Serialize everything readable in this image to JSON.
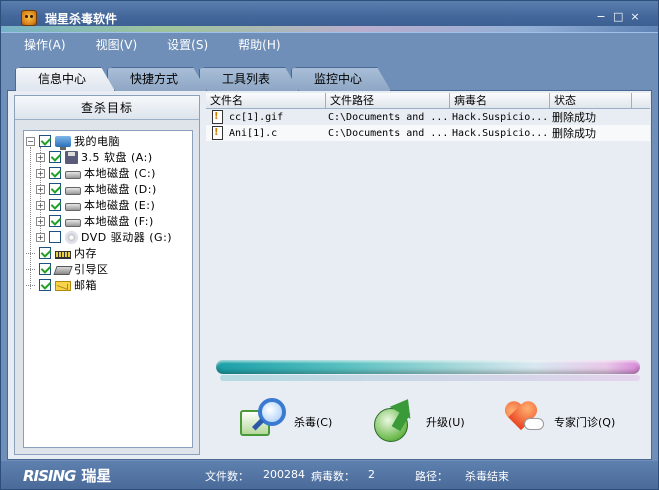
{
  "window": {
    "title": "瑞星杀毒软件",
    "controls": [
      "−",
      "□",
      "×"
    ]
  },
  "menu": [
    "操作(A)",
    "视图(V)",
    "设置(S)",
    "帮助(H)"
  ],
  "tabs": [
    "信息中心",
    "快捷方式",
    "工具列表",
    "监控中心"
  ],
  "left_panel": {
    "title": "查杀目标",
    "tree": {
      "root": "我的电脑",
      "drives": [
        {
          "label": "3.5 软盘 (A:)",
          "icon": "floppy-icon"
        },
        {
          "label": "本地磁盘 (C:)",
          "icon": "disk-icon"
        },
        {
          "label": "本地磁盘 (D:)",
          "icon": "disk-icon"
        },
        {
          "label": "本地磁盘 (E:)",
          "icon": "disk-icon"
        },
        {
          "label": "本地磁盘 (F:)",
          "icon": "disk-icon"
        },
        {
          "label": "DVD 驱动器 (G:)",
          "icon": "dvd-icon"
        }
      ],
      "others": [
        {
          "label": "内存",
          "icon": "memory-icon"
        },
        {
          "label": "引导区",
          "icon": "boot-sector-icon"
        },
        {
          "label": "邮箱",
          "icon": "mail-icon"
        }
      ]
    }
  },
  "list": {
    "columns": [
      "文件名",
      "文件路径",
      "病毒名",
      "状态"
    ],
    "rows": [
      {
        "filename": "cc[1].gif",
        "path": "C:\\Documents and ...",
        "virus": "Hack.Suspicio...",
        "status": "删除成功"
      },
      {
        "filename": "Ani[1].c",
        "path": "C:\\Documents and ...",
        "virus": "Hack.Suspicio...",
        "status": "删除成功"
      }
    ]
  },
  "actions": {
    "kill": "杀毒(C)",
    "upgrade": "升级(U)",
    "expert": "专家门诊(Q)"
  },
  "status": {
    "logo_en": "RISING",
    "logo_cn": "瑞星",
    "files_label": "文件数：",
    "files_value": "200284",
    "virus_label": "病毒数：",
    "virus_value": "2",
    "path_label": "路径：",
    "path_value": "杀毒结束"
  }
}
